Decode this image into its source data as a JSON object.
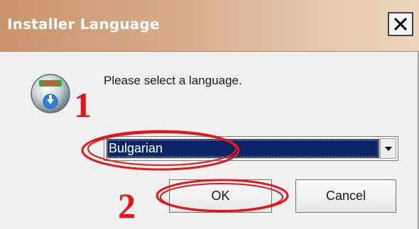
{
  "window": {
    "title": "Installer Language",
    "close_label": "X"
  },
  "dialog": {
    "icon": "installer-disk-icon",
    "prompt": "Please select a language."
  },
  "language_select": {
    "selected": "Bulgarian"
  },
  "buttons": {
    "ok": "OK",
    "cancel": "Cancel"
  },
  "annotations": {
    "step1": "1",
    "step2": "2",
    "color": "#e0181b"
  },
  "colors": {
    "titlebar": "#c9936c",
    "selection": "#0a2466"
  }
}
